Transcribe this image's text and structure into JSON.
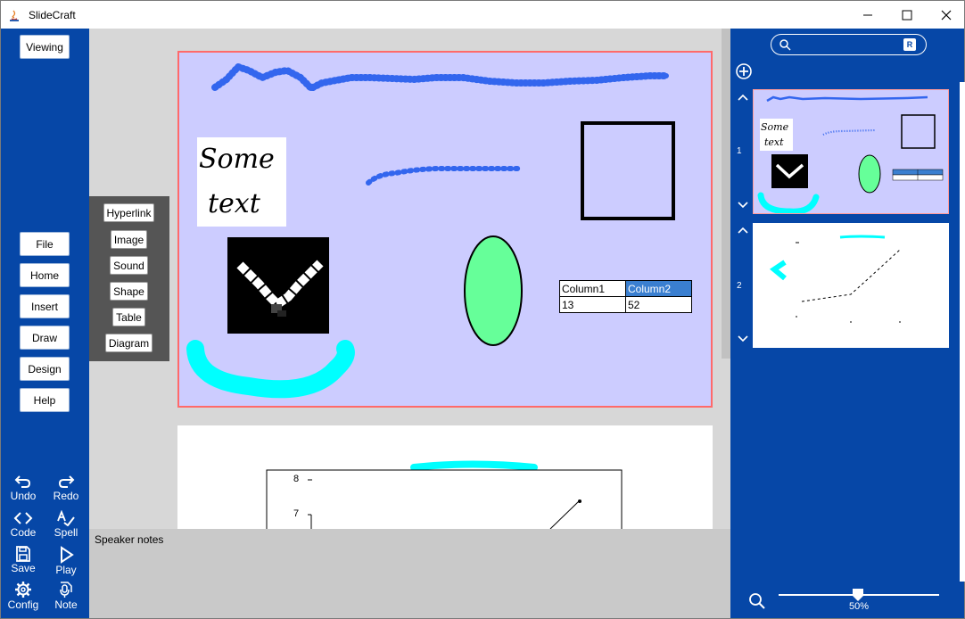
{
  "window": {
    "title": "SlideCraft",
    "controls": [
      "minimize-icon",
      "maximize-icon",
      "close-icon"
    ]
  },
  "leftnav": {
    "mode_button": "Viewing",
    "menu": [
      "File",
      "Home",
      "Insert",
      "Draw",
      "Design",
      "Help"
    ],
    "tools": [
      {
        "label": "Undo",
        "icon": "undo-icon"
      },
      {
        "label": "Redo",
        "icon": "redo-icon"
      },
      {
        "label": "Code",
        "icon": "code-icon"
      },
      {
        "label": "Spell",
        "icon": "spellcheck-icon"
      },
      {
        "label": "Save",
        "icon": "save-icon"
      },
      {
        "label": "Play",
        "icon": "play-icon"
      },
      {
        "label": "Config",
        "icon": "gear-icon"
      },
      {
        "label": "Note",
        "icon": "microphone-note-icon"
      }
    ]
  },
  "insert_menu": [
    "Hyperlink",
    "Image",
    "Sound",
    "Shape",
    "Table",
    "Diagram"
  ],
  "slide1": {
    "text_box": [
      "Some",
      "text"
    ],
    "table": {
      "headers": [
        "Column1",
        "Column2"
      ],
      "rows": [
        [
          "13",
          "52"
        ]
      ]
    }
  },
  "slide2": {
    "axis_ticks": [
      "8",
      "7"
    ]
  },
  "speaker_notes": {
    "label": "Speaker notes"
  },
  "right_panel": {
    "search_badge": "R",
    "thumbnails": [
      "1",
      "2"
    ],
    "zoom": "50%"
  },
  "colors": {
    "nav_blue": "#0647a7",
    "slide_bg": "#ccccff",
    "selection_border": "#ff6a6a",
    "ellipse": "#66ff99",
    "cyan_stroke": "#00ffff",
    "ink_blue": "#3366ee",
    "table_header": "#3a7fd0"
  }
}
